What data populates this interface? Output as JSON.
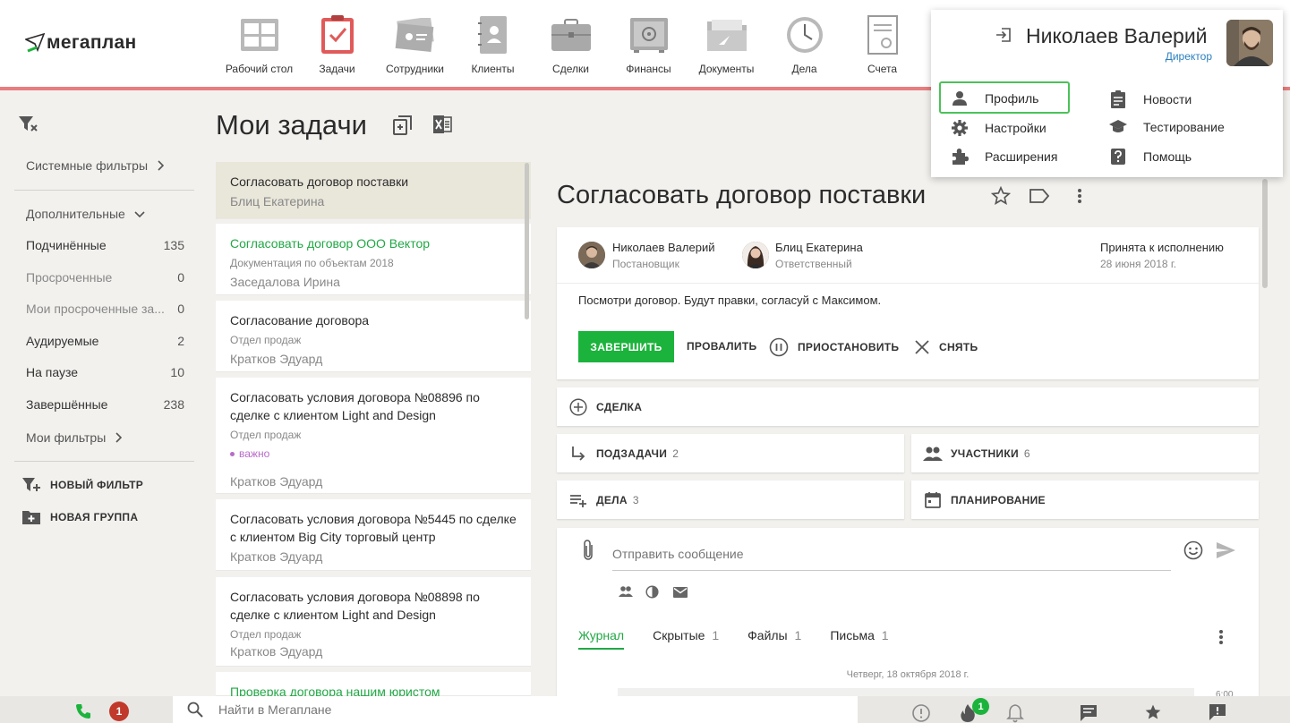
{
  "app": {
    "logo": "мегаплан"
  },
  "modules": [
    {
      "label": "Рабочий стол",
      "icon": "desktop-icon"
    },
    {
      "label": "Задачи",
      "icon": "tasks-icon"
    },
    {
      "label": "Сотрудники",
      "icon": "employees-icon"
    },
    {
      "label": "Клиенты",
      "icon": "clients-icon"
    },
    {
      "label": "Сделки",
      "icon": "deals-icon"
    },
    {
      "label": "Финансы",
      "icon": "finance-icon"
    },
    {
      "label": "Документы",
      "icon": "documents-icon"
    },
    {
      "label": "Дела",
      "icon": "clock-icon"
    },
    {
      "label": "Счета",
      "icon": "invoices-icon"
    }
  ],
  "user_menu": {
    "name": "Николаев Валерий",
    "role": "Директор",
    "items": [
      {
        "label": "Профиль",
        "icon": "person-icon"
      },
      {
        "label": "Новости",
        "icon": "clipboard-icon"
      },
      {
        "label": "Настройки",
        "icon": "gear-icon"
      },
      {
        "label": "Тестирование",
        "icon": "graduation-cap-icon"
      },
      {
        "label": "Расширения",
        "icon": "puzzle-icon"
      },
      {
        "label": "Помощь",
        "icon": "help-icon"
      }
    ]
  },
  "sidebar": {
    "system_filters": "Системные фильтры",
    "additional": "Дополнительные",
    "filters": [
      {
        "label": "Подчинённые",
        "count": "135"
      },
      {
        "label": "Просроченные",
        "count": "0"
      },
      {
        "label": "Мои просроченные за...",
        "count": "0"
      },
      {
        "label": "Аудируемые",
        "count": "2"
      },
      {
        "label": "На паузе",
        "count": "10"
      },
      {
        "label": "Завершённые",
        "count": "238"
      }
    ],
    "my_filters": "Мои фильтры",
    "new_filter": "НОВЫЙ ФИЛЬТР",
    "new_group": "НОВАЯ ГРУППА"
  },
  "page": {
    "title": "Мои задачи"
  },
  "tasks": [
    {
      "title": "Согласовать договор поставки",
      "owner": "Блиц Екатерина"
    },
    {
      "title": "Согласовать договор ООО Вектор",
      "project": "Документация по объектам 2018",
      "owner": "Заседалова Ирина"
    },
    {
      "title": "Согласование договора",
      "project": "Отдел продаж",
      "owner": "Кратков Эдуард"
    },
    {
      "title": "Согласовать условия договора №08896 по сделке с клиентом Light and Design",
      "project": "Отдел продаж",
      "tag": "важно",
      "owner": "Кратков Эдуард"
    },
    {
      "title": "Согласовать условия договора №5445 по сделке с клиентом Big City торговый центр",
      "owner": "Кратков Эдуард"
    },
    {
      "title": "Согласовать условия договора №08898 по сделке с клиентом Light and Design",
      "project": "Отдел продаж",
      "owner": "Кратков Эдуард"
    },
    {
      "title": "Проверка договора нашим юристом"
    }
  ],
  "detail": {
    "title": "Согласовать договор поставки",
    "author": {
      "name": "Николаев Валерий",
      "role": "Постановщик"
    },
    "responsible": {
      "name": "Блиц Екатерина",
      "role": "Ответственный"
    },
    "status": {
      "label": "Принята к исполнению",
      "date": "28 июня 2018 г."
    },
    "description": "Посмотри договор. Будут правки, согласуй с Максимом.",
    "actions": {
      "complete": "ЗАВЕРШИТЬ",
      "fail": "ПРОВАЛИТЬ",
      "pause": "ПРИОСТАНОВИТЬ",
      "remove": "СНЯТЬ"
    },
    "deal": "СДЕЛКА",
    "subtasks": {
      "label": "ПОДЗАДАЧИ",
      "count": "2"
    },
    "participants": {
      "label": "УЧАСТНИКИ",
      "count": "6"
    },
    "todos": {
      "label": "ДЕЛА",
      "count": "3"
    },
    "planning": "ПЛАНИРОВАНИЕ",
    "message_placeholder": "Отправить сообщение",
    "tabs": [
      {
        "label": "Журнал",
        "count": ""
      },
      {
        "label": "Скрытые",
        "count": "1"
      },
      {
        "label": "Файлы",
        "count": "1"
      },
      {
        "label": "Письма",
        "count": "1"
      }
    ],
    "journal_date": "Четверг, 18 октября 2018 г.",
    "journal_time": "6:00"
  },
  "bottom": {
    "call_badge": "1",
    "search_placeholder": "Найти в Мегаплане",
    "fire_badge": "1"
  },
  "colors": {
    "accent_green": "#1cb33c",
    "header_line": "#e87d7d",
    "badge_red": "#c0392b"
  }
}
